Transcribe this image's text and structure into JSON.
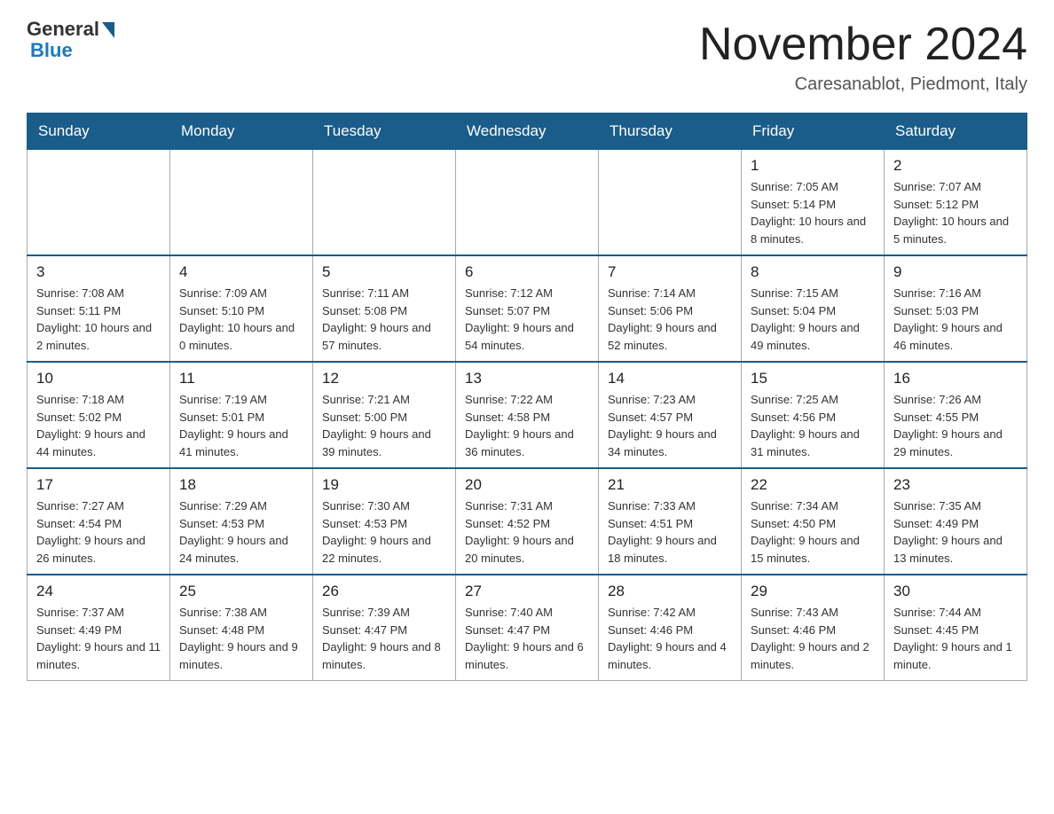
{
  "header": {
    "logo_general": "General",
    "logo_blue": "Blue",
    "month_title": "November 2024",
    "subtitle": "Caresanablot, Piedmont, Italy"
  },
  "days_of_week": [
    "Sunday",
    "Monday",
    "Tuesday",
    "Wednesday",
    "Thursday",
    "Friday",
    "Saturday"
  ],
  "weeks": [
    [
      {
        "day": "",
        "info": ""
      },
      {
        "day": "",
        "info": ""
      },
      {
        "day": "",
        "info": ""
      },
      {
        "day": "",
        "info": ""
      },
      {
        "day": "",
        "info": ""
      },
      {
        "day": "1",
        "info": "Sunrise: 7:05 AM\nSunset: 5:14 PM\nDaylight: 10 hours and 8 minutes."
      },
      {
        "day": "2",
        "info": "Sunrise: 7:07 AM\nSunset: 5:12 PM\nDaylight: 10 hours and 5 minutes."
      }
    ],
    [
      {
        "day": "3",
        "info": "Sunrise: 7:08 AM\nSunset: 5:11 PM\nDaylight: 10 hours and 2 minutes."
      },
      {
        "day": "4",
        "info": "Sunrise: 7:09 AM\nSunset: 5:10 PM\nDaylight: 10 hours and 0 minutes."
      },
      {
        "day": "5",
        "info": "Sunrise: 7:11 AM\nSunset: 5:08 PM\nDaylight: 9 hours and 57 minutes."
      },
      {
        "day": "6",
        "info": "Sunrise: 7:12 AM\nSunset: 5:07 PM\nDaylight: 9 hours and 54 minutes."
      },
      {
        "day": "7",
        "info": "Sunrise: 7:14 AM\nSunset: 5:06 PM\nDaylight: 9 hours and 52 minutes."
      },
      {
        "day": "8",
        "info": "Sunrise: 7:15 AM\nSunset: 5:04 PM\nDaylight: 9 hours and 49 minutes."
      },
      {
        "day": "9",
        "info": "Sunrise: 7:16 AM\nSunset: 5:03 PM\nDaylight: 9 hours and 46 minutes."
      }
    ],
    [
      {
        "day": "10",
        "info": "Sunrise: 7:18 AM\nSunset: 5:02 PM\nDaylight: 9 hours and 44 minutes."
      },
      {
        "day": "11",
        "info": "Sunrise: 7:19 AM\nSunset: 5:01 PM\nDaylight: 9 hours and 41 minutes."
      },
      {
        "day": "12",
        "info": "Sunrise: 7:21 AM\nSunset: 5:00 PM\nDaylight: 9 hours and 39 minutes."
      },
      {
        "day": "13",
        "info": "Sunrise: 7:22 AM\nSunset: 4:58 PM\nDaylight: 9 hours and 36 minutes."
      },
      {
        "day": "14",
        "info": "Sunrise: 7:23 AM\nSunset: 4:57 PM\nDaylight: 9 hours and 34 minutes."
      },
      {
        "day": "15",
        "info": "Sunrise: 7:25 AM\nSunset: 4:56 PM\nDaylight: 9 hours and 31 minutes."
      },
      {
        "day": "16",
        "info": "Sunrise: 7:26 AM\nSunset: 4:55 PM\nDaylight: 9 hours and 29 minutes."
      }
    ],
    [
      {
        "day": "17",
        "info": "Sunrise: 7:27 AM\nSunset: 4:54 PM\nDaylight: 9 hours and 26 minutes."
      },
      {
        "day": "18",
        "info": "Sunrise: 7:29 AM\nSunset: 4:53 PM\nDaylight: 9 hours and 24 minutes."
      },
      {
        "day": "19",
        "info": "Sunrise: 7:30 AM\nSunset: 4:53 PM\nDaylight: 9 hours and 22 minutes."
      },
      {
        "day": "20",
        "info": "Sunrise: 7:31 AM\nSunset: 4:52 PM\nDaylight: 9 hours and 20 minutes."
      },
      {
        "day": "21",
        "info": "Sunrise: 7:33 AM\nSunset: 4:51 PM\nDaylight: 9 hours and 18 minutes."
      },
      {
        "day": "22",
        "info": "Sunrise: 7:34 AM\nSunset: 4:50 PM\nDaylight: 9 hours and 15 minutes."
      },
      {
        "day": "23",
        "info": "Sunrise: 7:35 AM\nSunset: 4:49 PM\nDaylight: 9 hours and 13 minutes."
      }
    ],
    [
      {
        "day": "24",
        "info": "Sunrise: 7:37 AM\nSunset: 4:49 PM\nDaylight: 9 hours and 11 minutes."
      },
      {
        "day": "25",
        "info": "Sunrise: 7:38 AM\nSunset: 4:48 PM\nDaylight: 9 hours and 9 minutes."
      },
      {
        "day": "26",
        "info": "Sunrise: 7:39 AM\nSunset: 4:47 PM\nDaylight: 9 hours and 8 minutes."
      },
      {
        "day": "27",
        "info": "Sunrise: 7:40 AM\nSunset: 4:47 PM\nDaylight: 9 hours and 6 minutes."
      },
      {
        "day": "28",
        "info": "Sunrise: 7:42 AM\nSunset: 4:46 PM\nDaylight: 9 hours and 4 minutes."
      },
      {
        "day": "29",
        "info": "Sunrise: 7:43 AM\nSunset: 4:46 PM\nDaylight: 9 hours and 2 minutes."
      },
      {
        "day": "30",
        "info": "Sunrise: 7:44 AM\nSunset: 4:45 PM\nDaylight: 9 hours and 1 minute."
      }
    ]
  ]
}
